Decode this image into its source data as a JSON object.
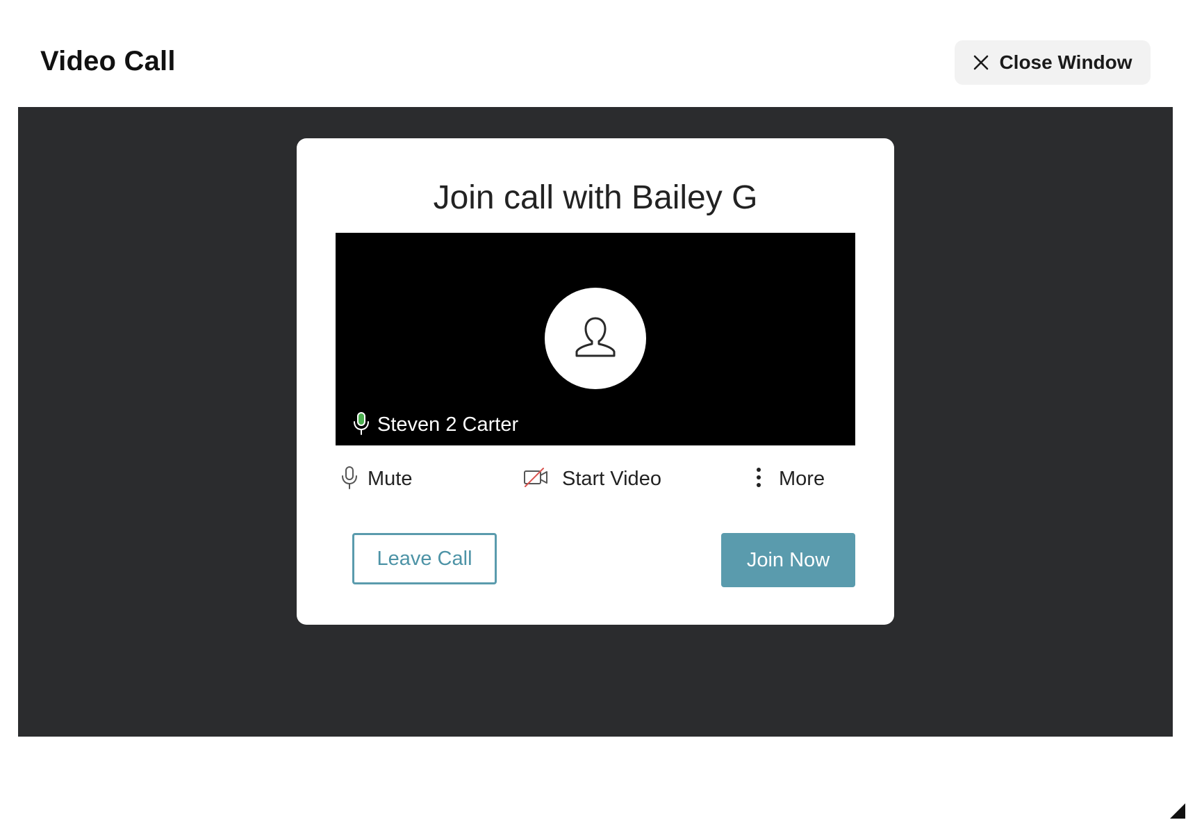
{
  "window": {
    "title": "Video Call",
    "close_label": "Close Window",
    "close_icon": "close-icon"
  },
  "dialog": {
    "title": "Join call with Bailey G",
    "preview": {
      "avatar_icon": "user-icon",
      "participant_name": "Steven 2 Carter",
      "mic_icon": "microphone-icon",
      "mic_active_color": "#4caf50"
    },
    "controls": {
      "mute_label": "Mute",
      "mute_icon": "microphone-icon",
      "video_label": "Start Video",
      "video_icon": "video-off-icon",
      "video_off_color": "#d9534f",
      "more_label": "More",
      "more_icon": "kebab-menu-icon"
    },
    "leave_label": "Leave Call",
    "join_label": "Join Now"
  },
  "colors": {
    "accent": "#5a9bad",
    "stage_background": "#2b2c2e",
    "preview_background": "#000000"
  }
}
